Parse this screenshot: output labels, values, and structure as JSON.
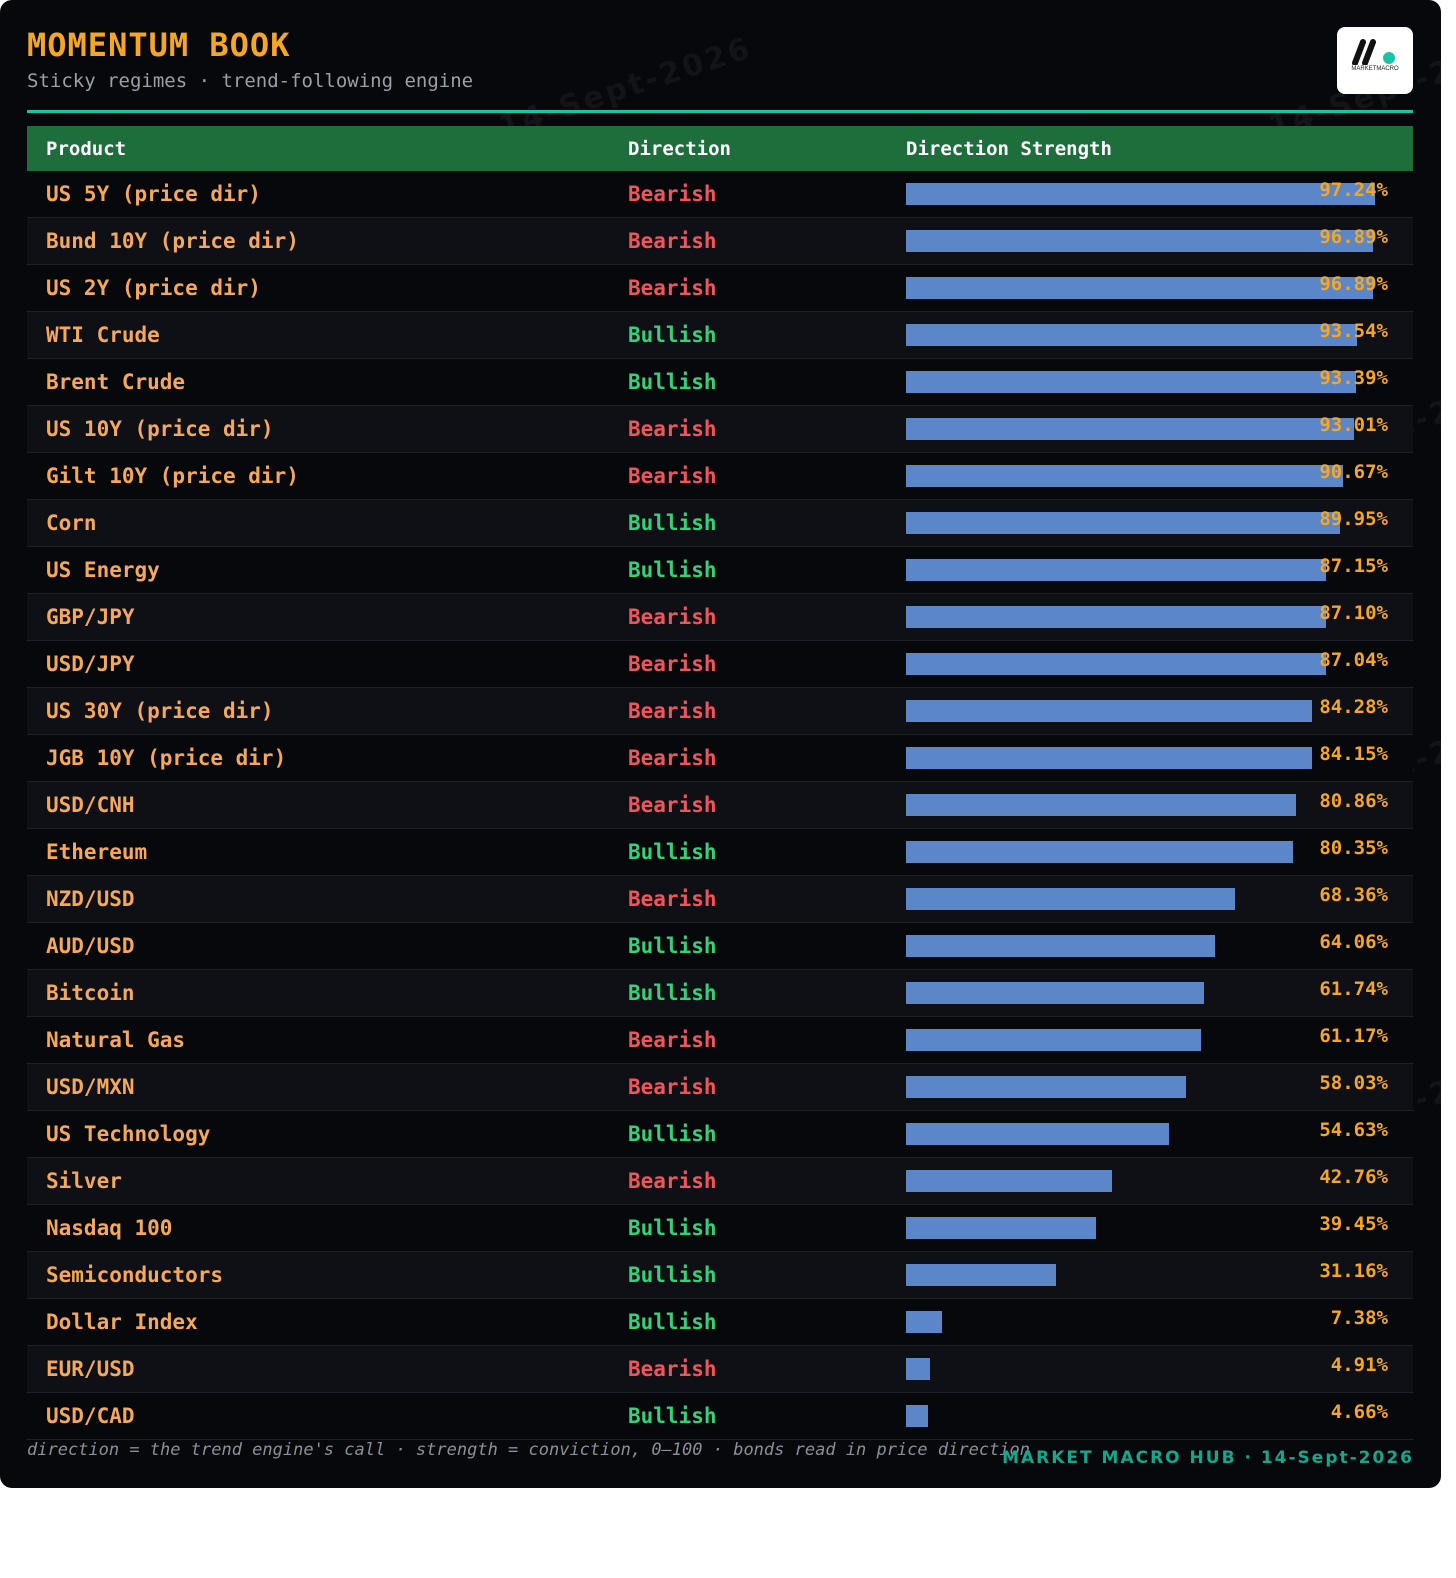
{
  "header": {
    "title": "MOMENTUM BOOK",
    "subtitle": "Sticky regimes · trend-following engine"
  },
  "logo": {
    "text": "MARKETMACRO",
    "accent": "#19c3a7"
  },
  "chart_data": {
    "type": "table",
    "columns": [
      "Product",
      "Direction",
      "Direction Strength"
    ],
    "value_range": [
      0,
      100
    ],
    "rows": [
      {
        "product": "US 5Y (price dir)",
        "direction": "Bearish",
        "strength": 97.24,
        "label": "97.24%"
      },
      {
        "product": "Bund 10Y (price dir)",
        "direction": "Bearish",
        "strength": 96.89,
        "label": "96.89%"
      },
      {
        "product": "US 2Y (price dir)",
        "direction": "Bearish",
        "strength": 96.89,
        "label": "96.89%"
      },
      {
        "product": "WTI Crude",
        "direction": "Bullish",
        "strength": 93.54,
        "label": "93.54%"
      },
      {
        "product": "Brent Crude",
        "direction": "Bullish",
        "strength": 93.39,
        "label": "93.39%"
      },
      {
        "product": "US 10Y (price dir)",
        "direction": "Bearish",
        "strength": 93.01,
        "label": "93.01%"
      },
      {
        "product": "Gilt 10Y (price dir)",
        "direction": "Bearish",
        "strength": 90.67,
        "label": "90.67%"
      },
      {
        "product": "Corn",
        "direction": "Bullish",
        "strength": 89.95,
        "label": "89.95%"
      },
      {
        "product": "US Energy",
        "direction": "Bullish",
        "strength": 87.15,
        "label": "87.15%"
      },
      {
        "product": "GBP/JPY",
        "direction": "Bearish",
        "strength": 87.1,
        "label": "87.10%"
      },
      {
        "product": "USD/JPY",
        "direction": "Bearish",
        "strength": 87.04,
        "label": "87.04%"
      },
      {
        "product": "US 30Y (price dir)",
        "direction": "Bearish",
        "strength": 84.28,
        "label": "84.28%"
      },
      {
        "product": "JGB 10Y (price dir)",
        "direction": "Bearish",
        "strength": 84.15,
        "label": "84.15%"
      },
      {
        "product": "USD/CNH",
        "direction": "Bearish",
        "strength": 80.86,
        "label": "80.86%"
      },
      {
        "product": "Ethereum",
        "direction": "Bullish",
        "strength": 80.35,
        "label": "80.35%"
      },
      {
        "product": "NZD/USD",
        "direction": "Bearish",
        "strength": 68.36,
        "label": "68.36%"
      },
      {
        "product": "AUD/USD",
        "direction": "Bullish",
        "strength": 64.06,
        "label": "64.06%"
      },
      {
        "product": "Bitcoin",
        "direction": "Bullish",
        "strength": 61.74,
        "label": "61.74%"
      },
      {
        "product": "Natural Gas",
        "direction": "Bearish",
        "strength": 61.17,
        "label": "61.17%"
      },
      {
        "product": "USD/MXN",
        "direction": "Bearish",
        "strength": 58.03,
        "label": "58.03%"
      },
      {
        "product": "US Technology",
        "direction": "Bullish",
        "strength": 54.63,
        "label": "54.63%"
      },
      {
        "product": "Silver",
        "direction": "Bearish",
        "strength": 42.76,
        "label": "42.76%"
      },
      {
        "product": "Nasdaq 100",
        "direction": "Bullish",
        "strength": 39.45,
        "label": "39.45%"
      },
      {
        "product": "Semiconductors",
        "direction": "Bullish",
        "strength": 31.16,
        "label": "31.16%"
      },
      {
        "product": "Dollar Index",
        "direction": "Bullish",
        "strength": 7.38,
        "label": "7.38%"
      },
      {
        "product": "EUR/USD",
        "direction": "Bearish",
        "strength": 4.91,
        "label": "4.91%"
      },
      {
        "product": "USD/CAD",
        "direction": "Bullish",
        "strength": 4.66,
        "label": "4.66%"
      }
    ],
    "colors": {
      "bar": "#5b86c8",
      "bearish": "#f2545b",
      "bullish": "#33d17a",
      "product": "#f5a85a",
      "percent": "#f5a623",
      "header_bg": "#1e6e3c"
    }
  },
  "watermark": {
    "text": "MARKET MACRO HUB · 14-Sept-2026"
  },
  "footer": {
    "note": "direction = the trend engine's call · strength = conviction, 0–100 · bonds read in price direction",
    "brand": "MARKET MACRO HUB · 14-Sept-2026"
  }
}
